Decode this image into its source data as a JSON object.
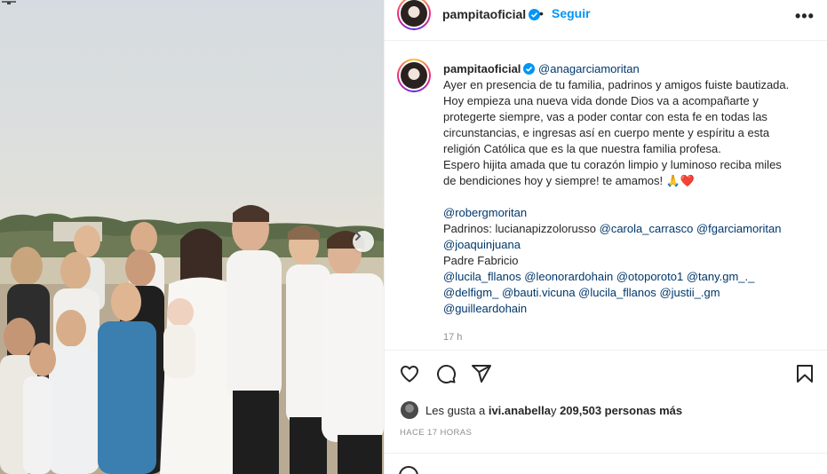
{
  "header": {
    "username": "pampitaoficial",
    "separator": "•",
    "follow_label": "Seguir",
    "more_label": "•••"
  },
  "caption": {
    "username": "pampitaoficial",
    "mention_top": "@anagarciamoritan",
    "lines": [
      "Ayer en presencia de tu familia, padrinos y amigos fuiste bautizada.",
      "Hoy empieza una nueva vida donde Dios va a acompañarte y",
      "protegerte siempre, vas a poder contar con esta fe en todas las",
      "circunstancias, e ingresas así en cuerpo mente y espíritu a esta",
      "religión Católica que es la que nuestra familia profesa.",
      "Espero hijita amada que tu corazón limpio y luminoso reciba miles",
      "de bendiciones hoy y siempre! te amamos! 🙏❤️"
    ],
    "mention_robergmoritan": "@robergmoritan",
    "padrinos_label": "Padrinos: ",
    "padrinos_mentions": [
      "lucianapizzolorusso",
      "@carola_carrasco",
      "@fgarciamoritan",
      "@joaquinjuana"
    ],
    "padre_label": "Padre Fabricio",
    "friend_mentions_line1": [
      "@lucila_fllanos",
      "@leonorardohain",
      "@otoporoto1",
      "@tany.gm_._"
    ],
    "friend_mentions_line2": [
      "@delfigm_",
      "@bauti.vicuna",
      "@lucila_fllanos",
      "@justii_.gm"
    ],
    "friend_mentions_line3": [
      "@guilleardohain"
    ],
    "time": "17 h"
  },
  "likes": {
    "prefix": "Les gusta a ",
    "user": "ivi.anabella",
    "middle": " y ",
    "count": "209,503 personas más"
  },
  "posted_ago": "HACE 17 HORAS",
  "icons": [
    "heart-icon",
    "comment-icon",
    "share-icon",
    "bookmark-icon",
    "verified-icon",
    "more-icon",
    "chevron-right-icon",
    "emoji-icon"
  ],
  "colors": {
    "link": "#0095f6",
    "mention": "#00376b",
    "verified": "#0095f6",
    "muted": "#8e8e8e"
  }
}
